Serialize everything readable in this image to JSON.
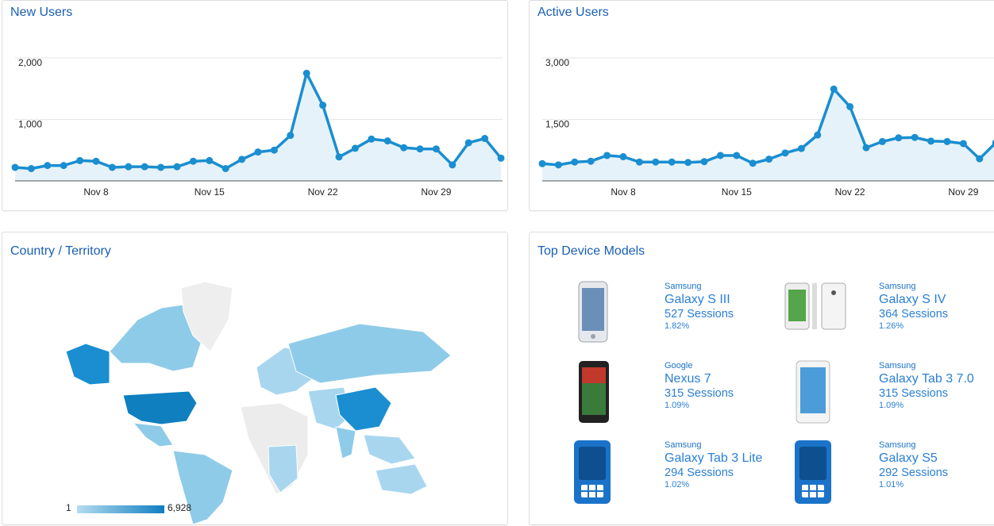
{
  "new_users": {
    "title": "New Users",
    "color": "#1a8ed0",
    "chart_data": {
      "type": "area",
      "title": "New Users",
      "y_ticks": [
        "2,000",
        "1,000"
      ],
      "x_ticks": [
        "Nov 8",
        "Nov 15",
        "Nov 22",
        "Nov 29"
      ],
      "ylim": [
        0,
        2000
      ],
      "x": [
        "Nov 3",
        "Nov 4",
        "Nov 5",
        "Nov 6",
        "Nov 7",
        "Nov 8",
        "Nov 9",
        "Nov 10",
        "Nov 11",
        "Nov 12",
        "Nov 13",
        "Nov 14",
        "Nov 15",
        "Nov 16",
        "Nov 17",
        "Nov 18",
        "Nov 19",
        "Nov 20",
        "Nov 21",
        "Nov 22",
        "Nov 23",
        "Nov 24",
        "Nov 25",
        "Nov 26",
        "Nov 27",
        "Nov 28",
        "Nov 29",
        "Nov 30",
        "Dec 1",
        "Dec 2",
        "Dec 3",
        "Dec 4"
      ],
      "values": [
        220,
        200,
        250,
        250,
        330,
        320,
        220,
        230,
        230,
        220,
        230,
        320,
        330,
        200,
        350,
        470,
        500,
        740,
        1750,
        1230,
        390,
        530,
        680,
        650,
        540,
        520,
        520,
        260,
        620,
        690,
        370,
        0
      ]
    }
  },
  "active_users": {
    "title": "Active Users",
    "color": "#1a8ed0",
    "chart_data": {
      "type": "area",
      "title": "Active Users",
      "y_ticks": [
        "3,000",
        "1,500"
      ],
      "x_ticks": [
        "Nov 8",
        "Nov 15",
        "Nov 22",
        "Nov 29"
      ],
      "ylim": [
        0,
        3000
      ],
      "x": [
        "Nov 3",
        "Nov 4",
        "Nov 5",
        "Nov 6",
        "Nov 7",
        "Nov 8",
        "Nov 9",
        "Nov 10",
        "Nov 11",
        "Nov 12",
        "Nov 13",
        "Nov 14",
        "Nov 15",
        "Nov 16",
        "Nov 17",
        "Nov 18",
        "Nov 19",
        "Nov 20",
        "Nov 21",
        "Nov 22",
        "Nov 23",
        "Nov 24",
        "Nov 25",
        "Nov 26",
        "Nov 27",
        "Nov 28",
        "Nov 29",
        "Nov 30",
        "Dec 1"
      ],
      "values": [
        420,
        390,
        460,
        480,
        620,
        590,
        460,
        460,
        460,
        450,
        470,
        620,
        620,
        430,
        530,
        680,
        790,
        1120,
        2240,
        1810,
        810,
        960,
        1050,
        1060,
        970,
        960,
        910,
        540,
        930
      ]
    }
  },
  "country": {
    "title": "Country / Territory",
    "legend_min": "1",
    "legend_max": "6,928"
  },
  "devices": {
    "title": "Top Device Models",
    "items": [
      {
        "brand": "Samsung",
        "model": "Galaxy S III",
        "sessions": "527 Sessions",
        "pct": "1.82%",
        "icon": "phone-image"
      },
      {
        "brand": "Samsung",
        "model": "Galaxy S IV",
        "sessions": "364 Sessions",
        "pct": "1.26%",
        "icon": "phone-image"
      },
      {
        "brand": "Google",
        "model": "Nexus 7",
        "sessions": "315 Sessions",
        "pct": "1.09%",
        "icon": "tablet-image"
      },
      {
        "brand": "Samsung",
        "model": "Galaxy Tab 3 7.0",
        "sessions": "315 Sessions",
        "pct": "1.09%",
        "icon": "tablet-image"
      },
      {
        "brand": "Samsung",
        "model": "Galaxy Tab 3 Lite",
        "sessions": "294 Sessions",
        "pct": "1.02%",
        "icon": "generic-device-icon"
      },
      {
        "brand": "Samsung",
        "model": "Galaxy S5",
        "sessions": "292 Sessions",
        "pct": "1.01%",
        "icon": "generic-device-icon"
      }
    ]
  }
}
